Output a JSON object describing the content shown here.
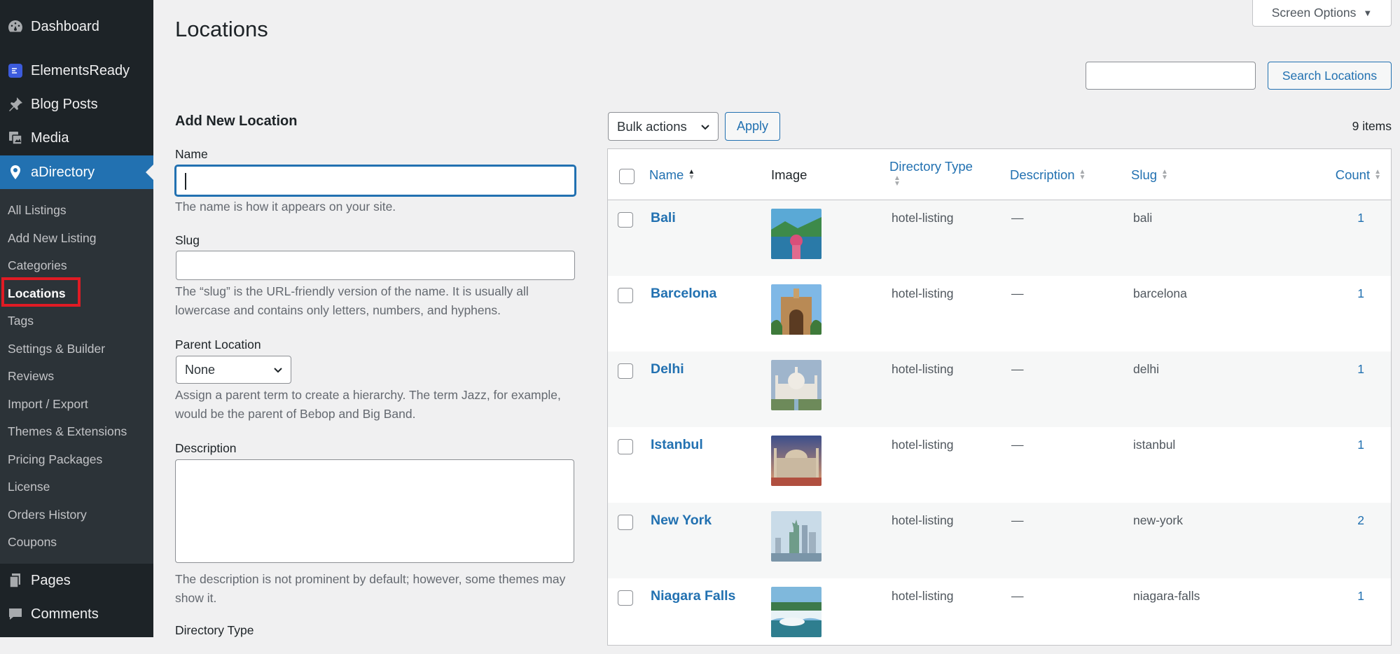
{
  "sidebar": {
    "top_items": [
      {
        "label": "Dashboard",
        "icon": "dashboard-icon"
      },
      {
        "label": "ElementsReady",
        "icon": "elementsready-icon"
      },
      {
        "label": "Blog Posts",
        "icon": "pin-icon"
      },
      {
        "label": "Media",
        "icon": "media-icon"
      },
      {
        "label": "aDirectory",
        "icon": "location-pin-icon"
      }
    ],
    "submenu": [
      "All Listings",
      "Add New Listing",
      "Categories",
      "Locations",
      "Tags",
      "Settings & Builder",
      "Reviews",
      "Import / Export",
      "Themes & Extensions",
      "Pricing Packages",
      "License",
      "Orders History",
      "Coupons"
    ],
    "bottom_items": [
      {
        "label": "Pages",
        "icon": "pages-icon"
      },
      {
        "label": "Comments",
        "icon": "comments-icon"
      }
    ],
    "active_submenu": "Locations",
    "accent": "#2271b1"
  },
  "header": {
    "title": "Locations",
    "screen_options": "Screen Options",
    "search_button": "Search Locations",
    "search_value": ""
  },
  "form": {
    "heading": "Add New Location",
    "name_label": "Name",
    "name_value": "",
    "name_help": "The name is how it appears on your site.",
    "slug_label": "Slug",
    "slug_value": "",
    "slug_help": "The “slug” is the URL-friendly version of the name. It is usually all lowercase and contains only letters, numbers, and hyphens.",
    "parent_label": "Parent Location",
    "parent_value": "None",
    "parent_help": "Assign a parent term to create a hierarchy. The term Jazz, for example, would be the parent of Bebop and Big Band.",
    "description_label": "Description",
    "description_help": "The description is not prominent by default; however, some themes may show it.",
    "directory_type_label": "Directory Type"
  },
  "table": {
    "bulk_actions": "Bulk actions",
    "apply": "Apply",
    "count": "9 items",
    "columns": {
      "name": "Name",
      "image": "Image",
      "directory_type": "Directory Type",
      "description": "Description",
      "slug": "Slug",
      "count": "Count"
    },
    "rows": [
      {
        "name": "Bali",
        "directory_type": "hotel-listing",
        "description": "—",
        "slug": "bali",
        "count": "1"
      },
      {
        "name": "Barcelona",
        "directory_type": "hotel-listing",
        "description": "—",
        "slug": "barcelona",
        "count": "1"
      },
      {
        "name": "Delhi",
        "directory_type": "hotel-listing",
        "description": "—",
        "slug": "delhi",
        "count": "1"
      },
      {
        "name": "Istanbul",
        "directory_type": "hotel-listing",
        "description": "—",
        "slug": "istanbul",
        "count": "1"
      },
      {
        "name": "New York",
        "directory_type": "hotel-listing",
        "description": "—",
        "slug": "new-york",
        "count": "2"
      },
      {
        "name": "Niagara Falls",
        "directory_type": "hotel-listing",
        "description": "—",
        "slug": "niagara-falls",
        "count": "1"
      }
    ]
  }
}
